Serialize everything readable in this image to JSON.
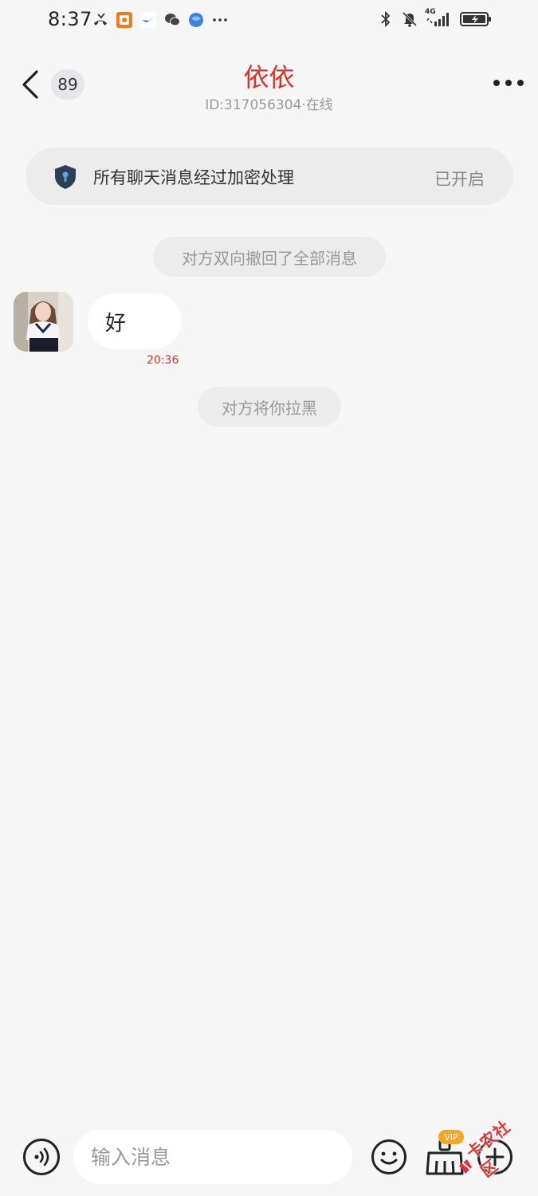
{
  "status_bar": {
    "time": "8:37",
    "left_icons": [
      "missed-call-icon",
      "app-icon-orange",
      "bird-app-icon",
      "wechat-icon",
      "browser-icon",
      "more-dots-icon"
    ],
    "right_icons": [
      "bluetooth-icon",
      "mute-bell-icon",
      "signal-4g-icon",
      "battery-charging-icon"
    ],
    "network_label": "4G"
  },
  "header": {
    "back_label": "back",
    "unread_count": "89",
    "title": "依依",
    "subtitle": "ID:317056304·在线"
  },
  "encrypt_banner": {
    "text": "所有聊天消息经过加密处理",
    "status": "已开启"
  },
  "messages": [
    {
      "type": "system",
      "text": "对方双向撤回了全部消息"
    },
    {
      "type": "incoming",
      "text": "好",
      "time": "20:36"
    },
    {
      "type": "system",
      "text": "对方将你拉黑"
    }
  ],
  "input_bar": {
    "placeholder": "输入消息",
    "vip_label": "VIP"
  },
  "watermark": {
    "text": "卡农社区"
  },
  "colors": {
    "accent": "#d8322a",
    "background": "#f6f6f6",
    "bubble": "#ffffff",
    "notice_bg": "#ececec",
    "vip": "#f5a623"
  }
}
